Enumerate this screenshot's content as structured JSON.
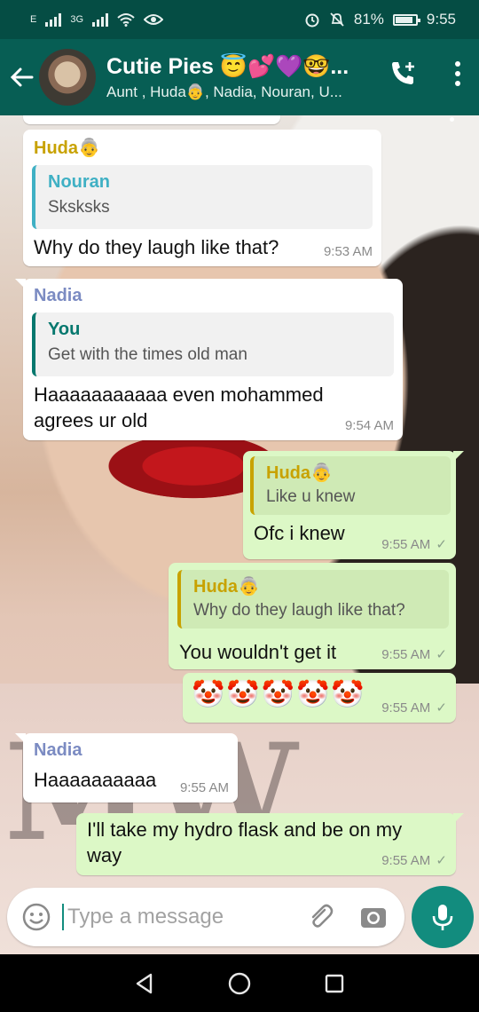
{
  "status_bar": {
    "network_left": "E",
    "network_mid": "3G",
    "battery": "81%",
    "time": "9:55"
  },
  "header": {
    "title": "Cutie Pies 😇💕💜🤓...",
    "subtitle": "Aunt , Huda👵, Nadia, Nouran, U...",
    "icon_back": "arrow-left-icon",
    "icon_call": "add-call-icon",
    "icon_menu": "kebab-menu-icon"
  },
  "messages": [
    {
      "direction": "in",
      "sender": "Huda👵",
      "sender_color": "#c8a200",
      "quote": {
        "name": "Nouran",
        "name_color": "#3fb0c4",
        "text": "Sksksks"
      },
      "text": "Why do they laugh like that?",
      "time": "9:53 AM"
    },
    {
      "direction": "in",
      "sender": "Nadia",
      "sender_color": "#7b8bc2",
      "quote": {
        "name": "You",
        "name_color": "#06786e",
        "text": "Get with the times old man"
      },
      "text": "Haaaaaaaaaaa even mohammed agrees ur old",
      "time": "9:54 AM"
    },
    {
      "direction": "out",
      "quote": {
        "name": "Huda👵",
        "name_color": "#c8a200",
        "text": "Like u knew"
      },
      "text": "Ofc i knew",
      "time": "9:55 AM"
    },
    {
      "direction": "out",
      "quote": {
        "name": "Huda👵",
        "name_color": "#c8a200",
        "text": "Why do they laugh like that?"
      },
      "text": "You wouldn't get it",
      "time": "9:55 AM"
    },
    {
      "direction": "out",
      "text": "🤡🤡🤡🤡🤡",
      "time": "9:55 AM"
    },
    {
      "direction": "in",
      "sender": "Nadia",
      "sender_color": "#7b8bc2",
      "text": "Haaaaaaaaaa",
      "time": "9:55 AM"
    },
    {
      "direction": "out",
      "text": "I'll take my hydro flask and be on my way",
      "time": "9:55 AM"
    }
  ],
  "tick_glyph": "✓",
  "composer": {
    "placeholder": "Type a message",
    "icons": [
      "emoji-icon",
      "attach-icon",
      "camera-icon",
      "mic-icon"
    ]
  },
  "nav": {
    "icons": [
      "back-triangle-icon",
      "home-circle-icon",
      "recents-square-icon"
    ]
  },
  "colors": {
    "header": "#075e54",
    "status_bar": "#054d44",
    "outgoing_bubble": "#dcf8c6",
    "accent": "#128c7e"
  }
}
